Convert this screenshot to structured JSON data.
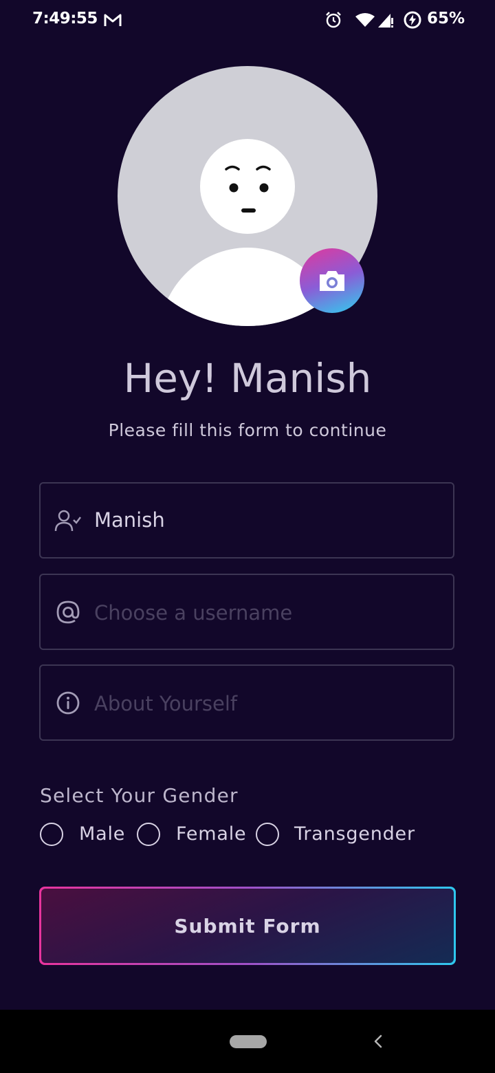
{
  "status_bar": {
    "time": "7:49:55",
    "battery_percent": "65%",
    "icons": [
      "gmail-icon",
      "alarm-icon",
      "wifi-icon",
      "signal-icon",
      "battery-charging-icon"
    ]
  },
  "profile": {
    "avatar_icon": "default-avatar-face",
    "camera_icon": "camera-icon",
    "camera_gradient": [
      "#e0399c",
      "#2ed0ee"
    ]
  },
  "header": {
    "greeting": "Hey! Manish",
    "subtitle": "Please fill this form to continue"
  },
  "form": {
    "name_field": {
      "icon": "user-check-icon",
      "value": "Manish"
    },
    "username_field": {
      "icon": "at-icon",
      "placeholder": "Choose a username",
      "value": ""
    },
    "about_field": {
      "icon": "info-icon",
      "placeholder": "About Yourself",
      "value": ""
    }
  },
  "gender": {
    "label": "Select Your Gender",
    "options": [
      "Male",
      "Female",
      "Transgender"
    ]
  },
  "submit": {
    "label": "Submit Form",
    "border_gradient": [
      "#e8349d",
      "#2ec8ee"
    ]
  },
  "colors": {
    "background": "#12072a",
    "text": "#cfc9db",
    "field_border": "#3c3553",
    "placeholder": "#4a4160"
  }
}
